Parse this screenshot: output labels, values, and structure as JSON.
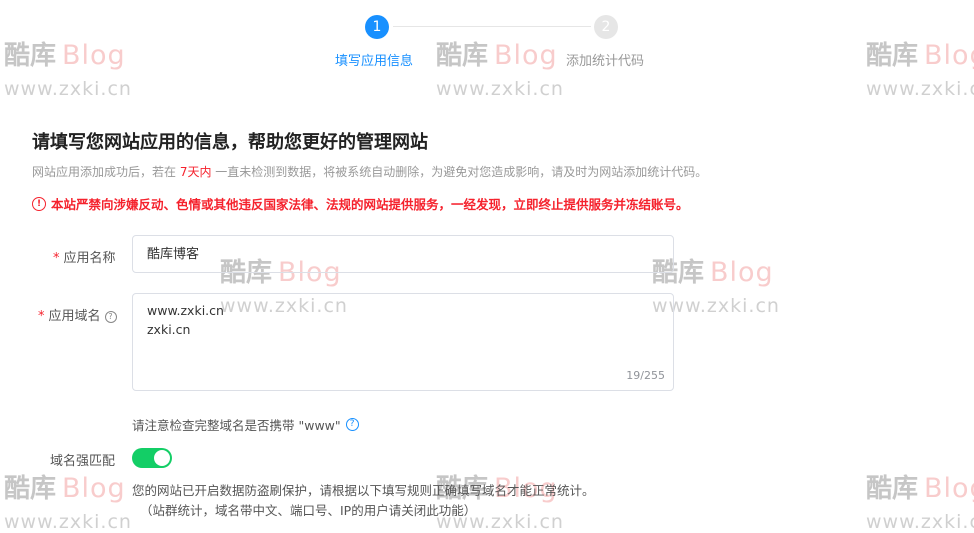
{
  "steps": [
    {
      "number": "1",
      "label": "填写应用信息",
      "state": "active"
    },
    {
      "number": "2",
      "label": "添加统计代码",
      "state": "inactive"
    }
  ],
  "heading": {
    "title": "请填写您网站应用的信息，帮助您更好的管理网站",
    "subtitle_before": "网站应用添加成功后，若在 ",
    "subtitle_highlight": "7天内",
    "subtitle_after": " 一直未检测到数据，将被系统自动删除，为避免对您造成影响，请及时为网站添加统计代码。",
    "warning": "本站严禁向涉嫌反动、色情或其他违反国家法律、法规的网站提供服务，一经发现，立即终止提供服务并冻结账号。"
  },
  "form": {
    "required_mark": "*",
    "app_name_label": "应用名称",
    "app_name_value": "酷库博客",
    "app_domain_label": "应用域名",
    "app_domain_lines": [
      "www.zxki.cn",
      "zxki.cn"
    ],
    "app_domain_counter": "19/255",
    "domain_hint": "请注意检查完整域名是否携带 \"www\"",
    "strict_match_label": "域名强匹配",
    "strict_match_on": true,
    "strict_match_desc_1": "您的网站已开启数据防盗刷保护，请根据以下填写规则正确填写域名才能正常统计。",
    "strict_match_desc_2": "（站群统计，域名带中文、端口号、IP的用户请关闭此功能）"
  },
  "watermark": {
    "brand": "酷库",
    "blog": "Blog",
    "url": "www.zxki.cn"
  },
  "colors": {
    "primary": "#1890ff",
    "danger": "#f5222d",
    "switch_on": "#13ce66"
  }
}
